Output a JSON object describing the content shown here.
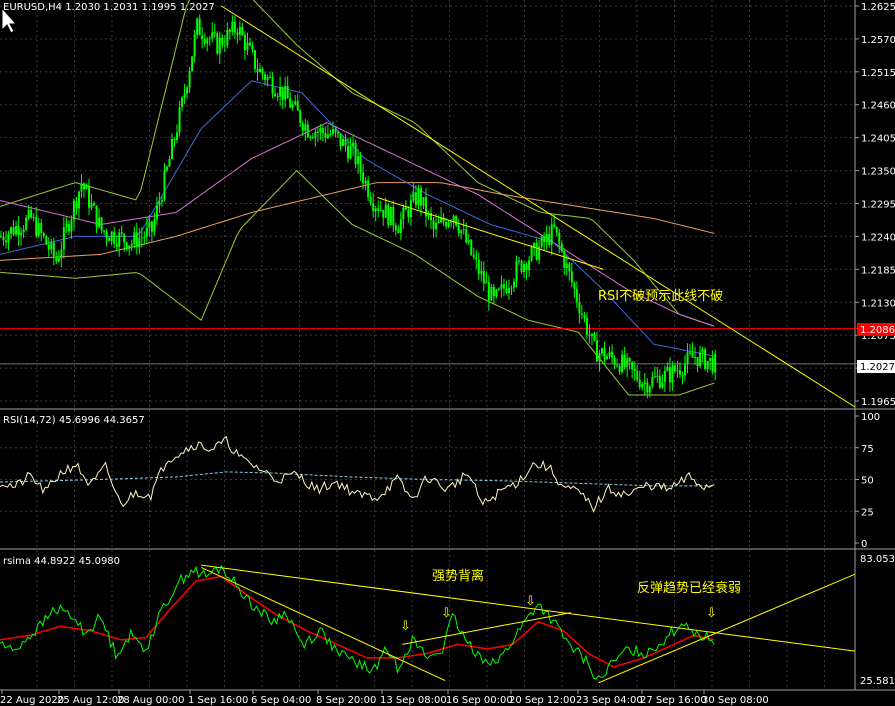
{
  "colors": {
    "background": "#000000",
    "grid": "#3a3a3a",
    "text": "#ffffff",
    "candle_up": "#00ff00",
    "candle_down": "#00ff00",
    "bollinger": "#9acd32",
    "ma_fast": "#4169e1",
    "ma_mid": "#da70d6",
    "ma_slow": "#e8a060",
    "rsi": "#fff5c0",
    "rsi_ma": "#87ceeb",
    "osma_fast": "#00ff00",
    "osma_slow": "#ff0000",
    "trendline": "#ffff00",
    "hline": "#ff0000",
    "price_badge_red": "#ff0000",
    "price_badge_cur": "#ffffff"
  },
  "panel_main": {
    "header": "EURUSD,H4  1.2030 1.2031 1.1995 1.2027",
    "y_ticks": [
      "1.2625",
      "1.2570",
      "1.2515",
      "1.2460",
      "1.2405",
      "1.2350",
      "1.2295",
      "1.2240",
      "1.2185",
      "1.2130",
      "1.2075",
      "1.2020",
      "1.1965"
    ],
    "red_line_label": "1.2086",
    "current_price_label": "1.2027",
    "annotation": "RSI不破预示此线不破"
  },
  "panel_rsi": {
    "header": "RSI(14,72) 45.6996 44.3657",
    "y_ticks": [
      "100",
      "75",
      "50",
      "25",
      "0"
    ]
  },
  "panel_osma": {
    "header": "rsima  44.8922 45.0980",
    "y_top": "83.0534",
    "y_bottom": "25.5813",
    "annotation_divergence": "强势背离",
    "annotation_weakening": "反弹趋势已经衰弱",
    "arrow_glyph": "⇩"
  },
  "x_axis": {
    "labels": [
      "22 Aug 2020",
      "25 Aug 12:00",
      "28 Aug 00:00",
      "1 Sep 16:00",
      "6 Sep 04:00",
      "8 Sep 20:00",
      "13 Sep 08:00",
      "16 Sep 00:00",
      "20 Sep 12:00",
      "23 Sep 04:00",
      "27 Sep 16:00",
      "30 Sep 08:00"
    ]
  },
  "chart_data": [
    {
      "type": "candlestick",
      "symbol": "EURUSD",
      "timeframe": "H4",
      "last_bar": {
        "open": 1.203,
        "high": 1.2031,
        "low": 1.1995,
        "close": 1.2027
      },
      "ylim": [
        1.1955,
        1.2635
      ],
      "horizontal_line": 1.2086,
      "close_path": [
        {
          "i": 0,
          "v": 1.224
        },
        {
          "i": 12,
          "v": 1.227
        },
        {
          "i": 22,
          "v": 1.22
        },
        {
          "i": 32,
          "v": 1.233
        },
        {
          "i": 40,
          "v": 1.225
        },
        {
          "i": 52,
          "v": 1.223
        },
        {
          "i": 60,
          "v": 1.225
        },
        {
          "i": 66,
          "v": 1.235
        },
        {
          "i": 72,
          "v": 1.246
        },
        {
          "i": 78,
          "v": 1.259
        },
        {
          "i": 86,
          "v": 1.256
        },
        {
          "i": 94,
          "v": 1.259
        },
        {
          "i": 102,
          "v": 1.252
        },
        {
          "i": 112,
          "v": 1.248
        },
        {
          "i": 122,
          "v": 1.242
        },
        {
          "i": 132,
          "v": 1.241
        },
        {
          "i": 140,
          "v": 1.238
        },
        {
          "i": 148,
          "v": 1.23
        },
        {
          "i": 158,
          "v": 1.226
        },
        {
          "i": 166,
          "v": 1.231
        },
        {
          "i": 172,
          "v": 1.225
        },
        {
          "i": 180,
          "v": 1.228
        },
        {
          "i": 188,
          "v": 1.22
        },
        {
          "i": 196,
          "v": 1.213
        },
        {
          "i": 206,
          "v": 1.219
        },
        {
          "i": 214,
          "v": 1.222
        },
        {
          "i": 220,
          "v": 1.225
        },
        {
          "i": 228,
          "v": 1.215
        },
        {
          "i": 236,
          "v": 1.205
        },
        {
          "i": 246,
          "v": 1.203
        },
        {
          "i": 256,
          "v": 1.1995
        },
        {
          "i": 266,
          "v": 1.201
        },
        {
          "i": 276,
          "v": 1.204
        },
        {
          "i": 284,
          "v": 1.2027
        }
      ],
      "bollinger_upper": [
        {
          "i": 0,
          "v": 1.229
        },
        {
          "i": 30,
          "v": 1.233
        },
        {
          "i": 55,
          "v": 1.23
        },
        {
          "i": 75,
          "v": 1.264
        },
        {
          "i": 95,
          "v": 1.266
        },
        {
          "i": 118,
          "v": 1.256
        },
        {
          "i": 140,
          "v": 1.248
        },
        {
          "i": 165,
          "v": 1.243
        },
        {
          "i": 190,
          "v": 1.233
        },
        {
          "i": 215,
          "v": 1.228
        },
        {
          "i": 235,
          "v": 1.227
        },
        {
          "i": 252,
          "v": 1.22
        },
        {
          "i": 270,
          "v": 1.211
        },
        {
          "i": 284,
          "v": 1.209
        }
      ],
      "bollinger_lower": [
        {
          "i": 0,
          "v": 1.218
        },
        {
          "i": 30,
          "v": 1.217
        },
        {
          "i": 55,
          "v": 1.218
        },
        {
          "i": 80,
          "v": 1.21
        },
        {
          "i": 95,
          "v": 1.225
        },
        {
          "i": 118,
          "v": 1.235
        },
        {
          "i": 140,
          "v": 1.226
        },
        {
          "i": 165,
          "v": 1.221
        },
        {
          "i": 190,
          "v": 1.214
        },
        {
          "i": 210,
          "v": 1.21
        },
        {
          "i": 230,
          "v": 1.208
        },
        {
          "i": 250,
          "v": 1.1975
        },
        {
          "i": 270,
          "v": 1.1975
        },
        {
          "i": 284,
          "v": 1.1995
        }
      ],
      "ma_fast": [
        {
          "i": 0,
          "v": 1.221
        },
        {
          "i": 30,
          "v": 1.224
        },
        {
          "i": 55,
          "v": 1.224
        },
        {
          "i": 80,
          "v": 1.242
        },
        {
          "i": 100,
          "v": 1.25
        },
        {
          "i": 120,
          "v": 1.248
        },
        {
          "i": 145,
          "v": 1.237
        },
        {
          "i": 170,
          "v": 1.231
        },
        {
          "i": 195,
          "v": 1.226
        },
        {
          "i": 220,
          "v": 1.223
        },
        {
          "i": 240,
          "v": 1.215
        },
        {
          "i": 260,
          "v": 1.206
        },
        {
          "i": 284,
          "v": 1.204
        }
      ],
      "ma_mid": [
        {
          "i": 0,
          "v": 1.23
        },
        {
          "i": 40,
          "v": 1.226
        },
        {
          "i": 70,
          "v": 1.228
        },
        {
          "i": 100,
          "v": 1.237
        },
        {
          "i": 130,
          "v": 1.243
        },
        {
          "i": 160,
          "v": 1.237
        },
        {
          "i": 190,
          "v": 1.231
        },
        {
          "i": 220,
          "v": 1.223
        },
        {
          "i": 250,
          "v": 1.215
        },
        {
          "i": 270,
          "v": 1.211
        },
        {
          "i": 284,
          "v": 1.209
        }
      ],
      "ma_slow": [
        {
          "i": 0,
          "v": 1.22
        },
        {
          "i": 40,
          "v": 1.221
        },
        {
          "i": 70,
          "v": 1.224
        },
        {
          "i": 100,
          "v": 1.228
        },
        {
          "i": 130,
          "v": 1.231
        },
        {
          "i": 150,
          "v": 1.233
        },
        {
          "i": 175,
          "v": 1.233
        },
        {
          "i": 200,
          "v": 1.231
        },
        {
          "i": 230,
          "v": 1.229
        },
        {
          "i": 260,
          "v": 1.227
        },
        {
          "i": 284,
          "v": 1.2245
        }
      ],
      "trendlines": [
        {
          "from": {
            "i": 88,
            "v": 1.2625
          },
          "to": {
            "i": 340,
            "v": 1.1955
          }
        },
        {
          "from": {
            "i": 150,
            "v": 1.2305
          },
          "to": {
            "i": 240,
            "v": 1.2185
          }
        }
      ]
    },
    {
      "type": "line",
      "name": "RSI(14,72)",
      "ylim": [
        0,
        100
      ],
      "levels": [
        75,
        50,
        25
      ],
      "rsi": [
        {
          "i": 0,
          "v": 48
        },
        {
          "i": 6,
          "v": 44
        },
        {
          "i": 12,
          "v": 53
        },
        {
          "i": 18,
          "v": 40
        },
        {
          "i": 24,
          "v": 55
        },
        {
          "i": 30,
          "v": 62
        },
        {
          "i": 36,
          "v": 45
        },
        {
          "i": 42,
          "v": 60
        },
        {
          "i": 48,
          "v": 30
        },
        {
          "i": 54,
          "v": 40
        },
        {
          "i": 60,
          "v": 38
        },
        {
          "i": 66,
          "v": 65
        },
        {
          "i": 72,
          "v": 72
        },
        {
          "i": 78,
          "v": 78
        },
        {
          "i": 84,
          "v": 74
        },
        {
          "i": 90,
          "v": 80
        },
        {
          "i": 96,
          "v": 66
        },
        {
          "i": 102,
          "v": 60
        },
        {
          "i": 110,
          "v": 50
        },
        {
          "i": 118,
          "v": 54
        },
        {
          "i": 126,
          "v": 42
        },
        {
          "i": 134,
          "v": 48
        },
        {
          "i": 142,
          "v": 38
        },
        {
          "i": 150,
          "v": 36
        },
        {
          "i": 158,
          "v": 50
        },
        {
          "i": 164,
          "v": 34
        },
        {
          "i": 170,
          "v": 52
        },
        {
          "i": 178,
          "v": 42
        },
        {
          "i": 186,
          "v": 55
        },
        {
          "i": 192,
          "v": 30
        },
        {
          "i": 200,
          "v": 42
        },
        {
          "i": 206,
          "v": 48
        },
        {
          "i": 212,
          "v": 62
        },
        {
          "i": 218,
          "v": 60
        },
        {
          "i": 224,
          "v": 44
        },
        {
          "i": 230,
          "v": 40
        },
        {
          "i": 236,
          "v": 28
        },
        {
          "i": 242,
          "v": 42
        },
        {
          "i": 250,
          "v": 38
        },
        {
          "i": 258,
          "v": 46
        },
        {
          "i": 266,
          "v": 42
        },
        {
          "i": 274,
          "v": 52
        },
        {
          "i": 280,
          "v": 44
        },
        {
          "i": 284,
          "v": 46
        }
      ],
      "rsi_ma": [
        {
          "i": 0,
          "v": 48
        },
        {
          "i": 40,
          "v": 50
        },
        {
          "i": 70,
          "v": 52
        },
        {
          "i": 90,
          "v": 56
        },
        {
          "i": 110,
          "v": 55
        },
        {
          "i": 140,
          "v": 52
        },
        {
          "i": 170,
          "v": 50
        },
        {
          "i": 200,
          "v": 49
        },
        {
          "i": 230,
          "v": 47
        },
        {
          "i": 260,
          "v": 45
        },
        {
          "i": 284,
          "v": 45
        }
      ]
    },
    {
      "type": "line",
      "name": "rsima",
      "ylim": [
        25.5813,
        83.0534
      ],
      "fast": [
        {
          "i": 0,
          "v": 45
        },
        {
          "i": 5,
          "v": 41
        },
        {
          "i": 10,
          "v": 46
        },
        {
          "i": 16,
          "v": 52
        },
        {
          "i": 22,
          "v": 60
        },
        {
          "i": 28,
          "v": 57
        },
        {
          "i": 34,
          "v": 49
        },
        {
          "i": 40,
          "v": 56
        },
        {
          "i": 46,
          "v": 40
        },
        {
          "i": 52,
          "v": 48
        },
        {
          "i": 58,
          "v": 42
        },
        {
          "i": 64,
          "v": 58
        },
        {
          "i": 70,
          "v": 70
        },
        {
          "i": 76,
          "v": 77
        },
        {
          "i": 82,
          "v": 74
        },
        {
          "i": 88,
          "v": 78
        },
        {
          "i": 94,
          "v": 70
        },
        {
          "i": 100,
          "v": 62
        },
        {
          "i": 108,
          "v": 54
        },
        {
          "i": 114,
          "v": 58
        },
        {
          "i": 120,
          "v": 44
        },
        {
          "i": 128,
          "v": 50
        },
        {
          "i": 134,
          "v": 40
        },
        {
          "i": 142,
          "v": 36
        },
        {
          "i": 148,
          "v": 32
        },
        {
          "i": 154,
          "v": 42
        },
        {
          "i": 158,
          "v": 34
        },
        {
          "i": 164,
          "v": 46
        },
        {
          "i": 170,
          "v": 38
        },
        {
          "i": 176,
          "v": 42
        },
        {
          "i": 180,
          "v": 56
        },
        {
          "i": 186,
          "v": 44
        },
        {
          "i": 192,
          "v": 38
        },
        {
          "i": 198,
          "v": 36
        },
        {
          "i": 204,
          "v": 46
        },
        {
          "i": 210,
          "v": 56
        },
        {
          "i": 214,
          "v": 62
        },
        {
          "i": 220,
          "v": 54
        },
        {
          "i": 226,
          "v": 44
        },
        {
          "i": 232,
          "v": 38
        },
        {
          "i": 238,
          "v": 28
        },
        {
          "i": 244,
          "v": 36
        },
        {
          "i": 250,
          "v": 42
        },
        {
          "i": 256,
          "v": 40
        },
        {
          "i": 262,
          "v": 44
        },
        {
          "i": 268,
          "v": 50
        },
        {
          "i": 272,
          "v": 54
        },
        {
          "i": 278,
          "v": 48
        },
        {
          "i": 284,
          "v": 46
        }
      ],
      "slow": [
        {
          "i": 0,
          "v": 46
        },
        {
          "i": 12,
          "v": 48
        },
        {
          "i": 24,
          "v": 52
        },
        {
          "i": 36,
          "v": 50
        },
        {
          "i": 48,
          "v": 46
        },
        {
          "i": 58,
          "v": 47
        },
        {
          "i": 68,
          "v": 60
        },
        {
          "i": 78,
          "v": 72
        },
        {
          "i": 88,
          "v": 74
        },
        {
          "i": 98,
          "v": 66
        },
        {
          "i": 110,
          "v": 57
        },
        {
          "i": 122,
          "v": 50
        },
        {
          "i": 134,
          "v": 44
        },
        {
          "i": 146,
          "v": 38
        },
        {
          "i": 158,
          "v": 38
        },
        {
          "i": 170,
          "v": 40
        },
        {
          "i": 182,
          "v": 44
        },
        {
          "i": 194,
          "v": 42
        },
        {
          "i": 204,
          "v": 44
        },
        {
          "i": 214,
          "v": 54
        },
        {
          "i": 224,
          "v": 50
        },
        {
          "i": 234,
          "v": 40
        },
        {
          "i": 244,
          "v": 34
        },
        {
          "i": 256,
          "v": 38
        },
        {
          "i": 268,
          "v": 44
        },
        {
          "i": 276,
          "v": 48
        },
        {
          "i": 284,
          "v": 46
        }
      ],
      "trendlines": [
        {
          "from": {
            "i": 80,
            "v": 79
          },
          "to": {
            "i": 340,
            "v": 41
          }
        },
        {
          "from": {
            "i": 80,
            "v": 78
          },
          "to": {
            "i": 177,
            "v": 28
          }
        },
        {
          "from": {
            "i": 160,
            "v": 44
          },
          "to": {
            "i": 227,
            "v": 58
          }
        },
        {
          "from": {
            "i": 238,
            "v": 27
          },
          "to": {
            "i": 340,
            "v": 75
          }
        }
      ]
    }
  ]
}
